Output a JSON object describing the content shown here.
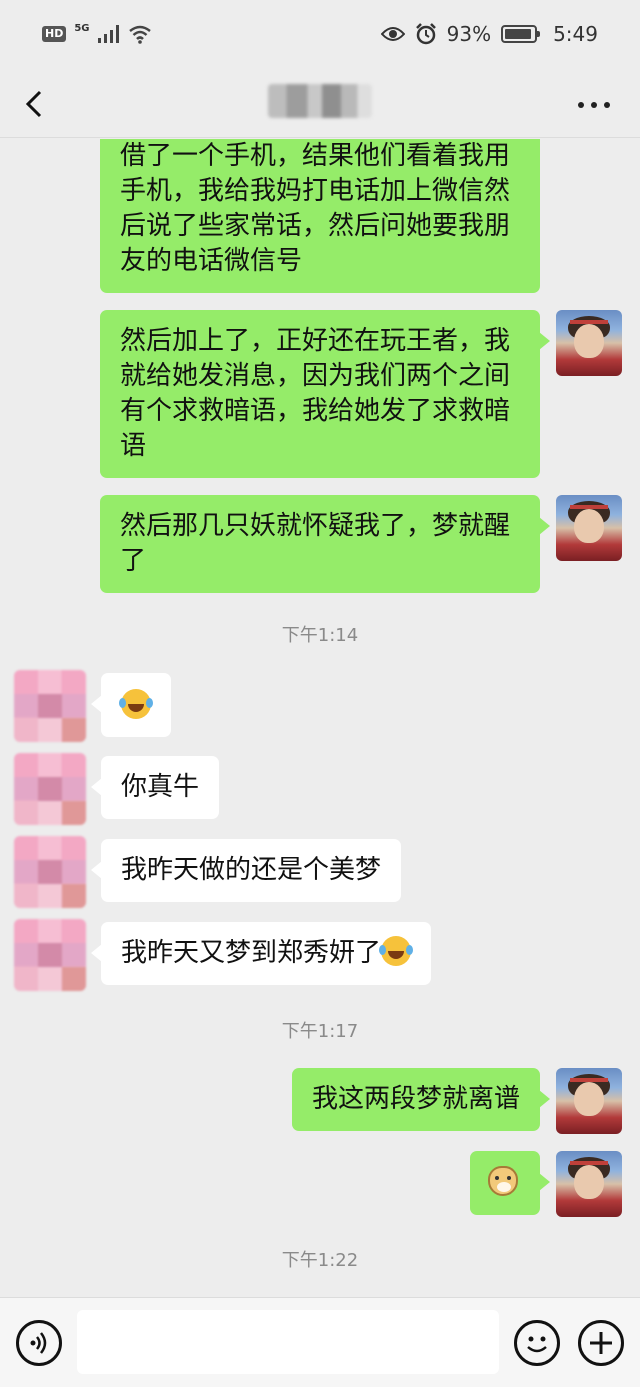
{
  "status_bar": {
    "hd_label": "HD",
    "network_label": "5G",
    "battery_percent": "93%",
    "battery_level": 0.93,
    "time": "5:49"
  },
  "nav": {
    "back_icon": "chevron-left-icon",
    "more_icon": "more-dots-icon"
  },
  "messages": [
    {
      "side": "me",
      "text": "借了一个手机，结果他们看着我用手机，我给我妈打电话加上微信然后说了些家常话，然后问她要我朋友的电话微信号"
    },
    {
      "side": "me",
      "text": "然后加上了，正好还在玩王者，我就给她发消息，因为我们两个之间有个求救暗语，我给她发了求救暗语"
    },
    {
      "side": "me",
      "text": "然后那几只妖就怀疑我了，梦就醒了"
    },
    {
      "side": "time",
      "text": "下午1:14"
    },
    {
      "side": "other",
      "emoji": "laughing-tears-emoji"
    },
    {
      "side": "other",
      "text": "你真牛"
    },
    {
      "side": "other",
      "text": "我昨天做的还是个美梦"
    },
    {
      "side": "other",
      "text": "我昨天又梦到郑秀妍了",
      "emoji": "laughing-tears-emoji"
    },
    {
      "side": "time",
      "text": "下午1:17"
    },
    {
      "side": "me",
      "text": "我这两段梦就离谱"
    },
    {
      "side": "me",
      "emoji": "doge-emoji"
    },
    {
      "side": "time",
      "text": "下午1:22"
    }
  ],
  "input_bar": {
    "voice_icon": "voice-icon",
    "emoji_icon": "emoji-icon",
    "plus_icon": "plus-icon",
    "input_value": ""
  },
  "colors": {
    "background": "#ededed",
    "my_bubble": "#95ec69",
    "their_bubble": "#ffffff",
    "timestamp": "#8a8a8a"
  }
}
